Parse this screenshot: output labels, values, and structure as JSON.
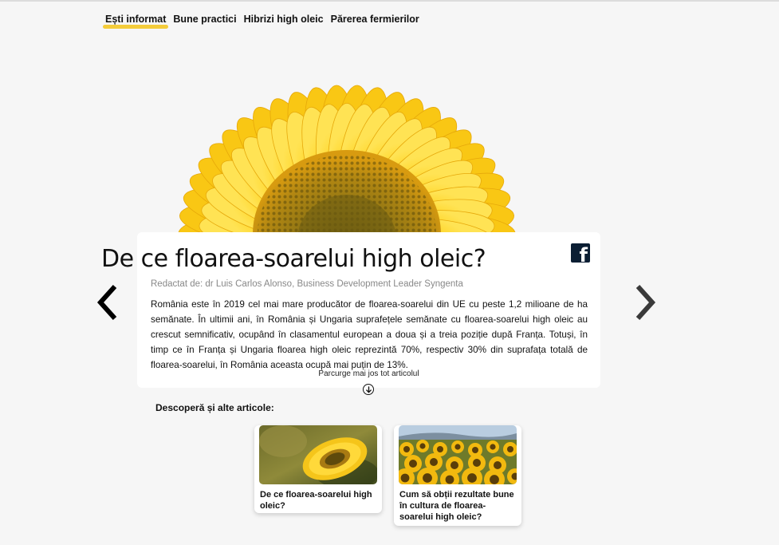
{
  "nav": {
    "items": [
      {
        "label": "Ești informat",
        "active": true
      },
      {
        "label": "Bune practici",
        "active": false
      },
      {
        "label": "Hibrizi high oleic",
        "active": false
      },
      {
        "label": "Părerea fermierilor",
        "active": false
      }
    ]
  },
  "article": {
    "title": "De ce floarea-soarelui high oleic?",
    "author": "Redactat de: dr Luis Carlos Alonso, Business Development Leader Syngenta",
    "body": "România este în 2019 cel mai mare producător de floarea-soarelui din UE cu peste 1,2 milioane de ha semănate. În ultimii ani, în România și Ungaria suprafețele semănate cu floarea-soarelui high oleic au crescut semnificativ, ocupând în clasamentul european a doua și a treia poziție după Franța. Totuși, în timp ce în Franța și Ungaria floarea high oleic reprezintă 70%, respectiv 30% din suprafața totală de floarea-soarelui, în România aceasta ocupă mai puțin de 13%.",
    "scroll_hint": "Parcurge mai jos tot articolul"
  },
  "share": {
    "facebook_glyph": "f"
  },
  "discover": {
    "heading": "Descoperă și alte articole:",
    "articles": [
      {
        "title": "De ce floarea-soarelui high oleic?"
      },
      {
        "title": "Cum să obții rezultate bune în cultura de floarea-soarelui high oleic?"
      }
    ]
  },
  "colors": {
    "accent": "#f4cc3b",
    "facebook": "#0b1e33",
    "background": "#f6f6f6"
  },
  "icons": [
    "facebook-icon",
    "chevron-left-icon",
    "chevron-right-icon",
    "arrow-down-circle-icon"
  ]
}
